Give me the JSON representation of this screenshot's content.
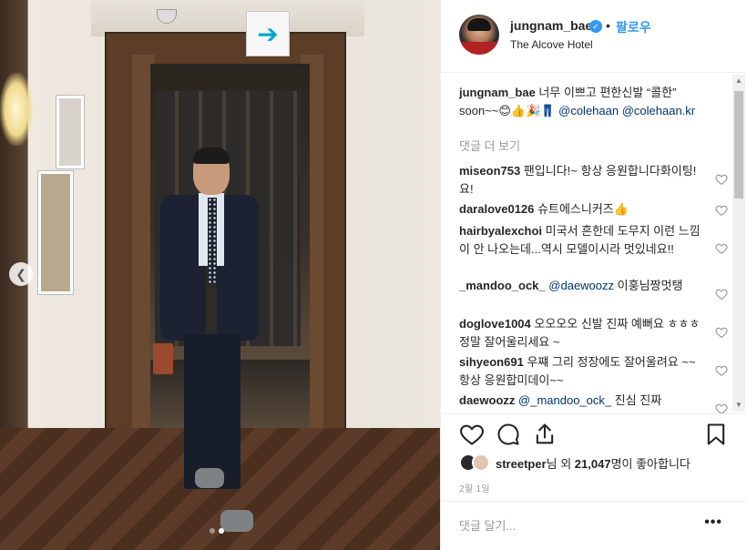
{
  "post": {
    "username": "jungnam_bae",
    "follow_label": "팔로우",
    "separator": "•",
    "location": "The Alcove Hotel",
    "caption": {
      "username": "jungnam_bae",
      "text": "너무 이쁘고 편한신발 “콜한” soon~~😊👍🎉👖",
      "tag1": "@colehaan",
      "tag2": "@colehaan.kr"
    },
    "more_comments_label": "댓글 더 보기",
    "comments": [
      {
        "username": "miseon753",
        "text": "팬입니다!~ 항상 응원합니다화이팅!요!"
      },
      {
        "username": "daralove0126",
        "text": "슈트에스니커즈👍"
      },
      {
        "username": "hairbyalexchoi",
        "text": "미국서 흔한데 도무지 이런 느낌이 안 나오는데...역시 모델이시라 멋있네요!!"
      },
      {
        "username": "_mandoo_ock_",
        "tag": "@daewoozz",
        "text": "이훙님짱멋탱"
      },
      {
        "username": "doglove1004",
        "text": "오오오오 신발 진짜 예뻐요 ㅎㅎㅎ 정말 잘어울리세요 ~"
      },
      {
        "username": "sihyeon691",
        "text": "우쨰 그리 정장에도 잘어울려요 ~~항상 응원합미데이~~"
      },
      {
        "username": "daewoozz",
        "tag": "@_mandoo_ock_",
        "text": "진심 진짜"
      }
    ],
    "likes": {
      "liker": "streetper",
      "text_mid": "님 외 ",
      "count": "21,047",
      "text_end": "명이 좋아합니다"
    },
    "date": "2월 1일",
    "comment_placeholder": "댓글 달기...",
    "more_options": "•••",
    "carousel": {
      "count": 2,
      "active": 1
    }
  },
  "colors": {
    "accent": "#3897f0",
    "text": "#262626",
    "muted": "#999999",
    "tag": "#003569"
  },
  "icons": [
    "camera-icon",
    "exit-arrow-icon",
    "chevron-left-icon",
    "verified-badge-icon",
    "heart-icon",
    "comment-icon",
    "share-icon",
    "bookmark-icon",
    "more-options-icon"
  ]
}
